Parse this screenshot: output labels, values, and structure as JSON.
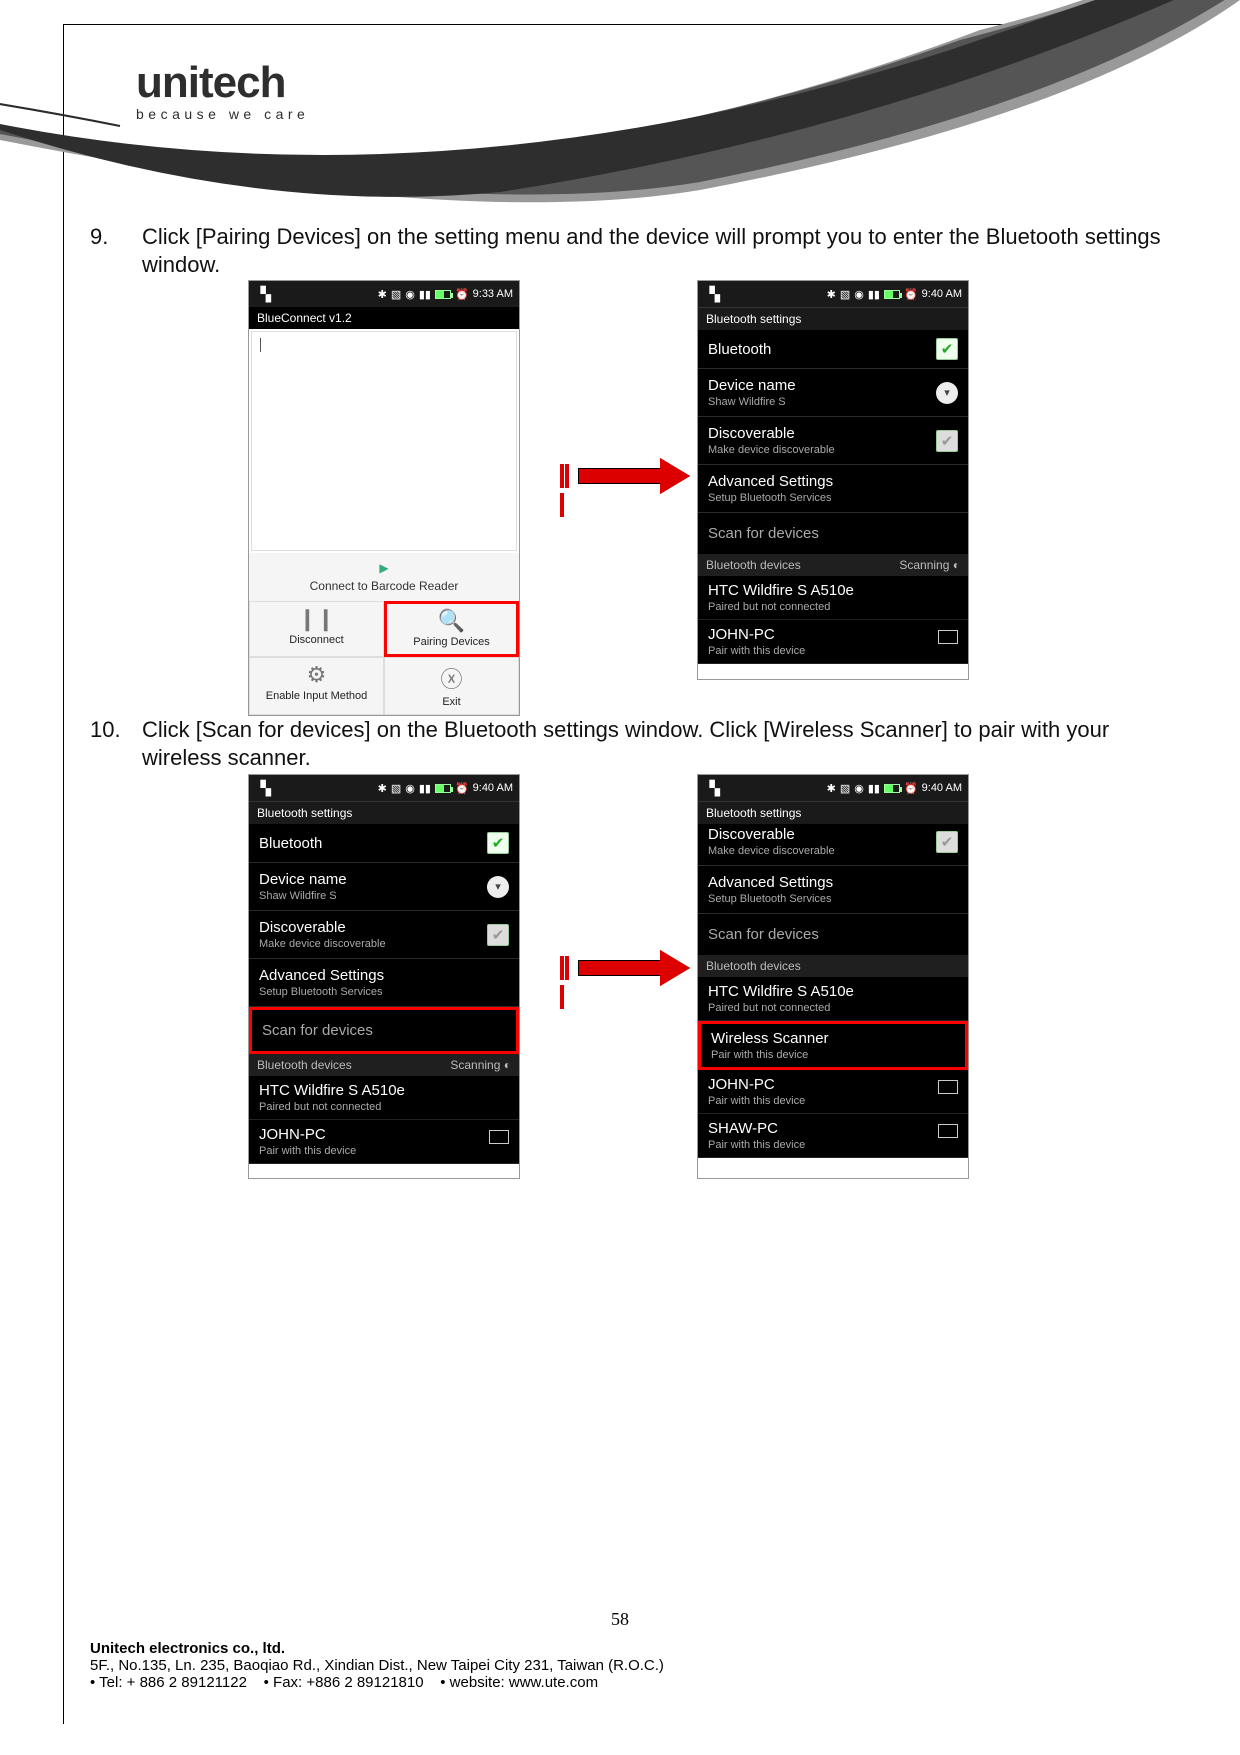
{
  "logo": {
    "main": "unitech",
    "tagline": "because we care"
  },
  "steps": [
    {
      "num": "9.",
      "text": "Click [Pairing Devices] on the setting menu and the device will prompt you to enter the Bluetooth settings window."
    },
    {
      "num": "10.",
      "text": "Click [Scan for devices] on the Bluetooth settings window. Click [Wireless Scanner] to pair with your wireless scanner."
    }
  ],
  "status": {
    "time933": "9:33 AM",
    "time940": "9:40 AM"
  },
  "blueconnect": {
    "title": "BlueConnect v1.2",
    "connect_row": "Connect to Barcode Reader",
    "cells": {
      "disconnect": "Disconnect",
      "pairing": "Pairing Devices",
      "enable_input": "Enable Input Method",
      "exit": "Exit"
    }
  },
  "bt": {
    "header": "Bluetooth settings",
    "bluetooth": "Bluetooth",
    "device_name": "Device name",
    "device_name_sub": "Shaw Wildfire S",
    "discoverable": "Discoverable",
    "discoverable_sub": "Make device discoverable",
    "advanced": "Advanced Settings",
    "advanced_sub": "Setup Bluetooth Services",
    "scan": "Scan for devices",
    "section": "Bluetooth devices",
    "scanning": "Scanning",
    "devices": {
      "htc": {
        "name": "HTC Wildfire S A510e",
        "sub_paired": "Paired but not connected"
      },
      "john": {
        "name": "JOHN-PC",
        "sub_pair": "Pair with this device"
      },
      "wireless": {
        "name": "Wireless Scanner",
        "sub_pair": "Pair with this device"
      },
      "shaw": {
        "name": "SHAW-PC",
        "sub_pair": "Pair with this device"
      }
    }
  },
  "footer": {
    "page": "58",
    "company": "Unitech electronics co., ltd.",
    "address": "5F., No.135, Ln. 235, Baoqiao Rd., Xindian Dist., New Taipei City 231, Taiwan (R.O.C.)",
    "tel": "Tel: + 886 2 89121122",
    "fax": "Fax: +886 2 89121810",
    "web": "website: www.ute.com"
  }
}
